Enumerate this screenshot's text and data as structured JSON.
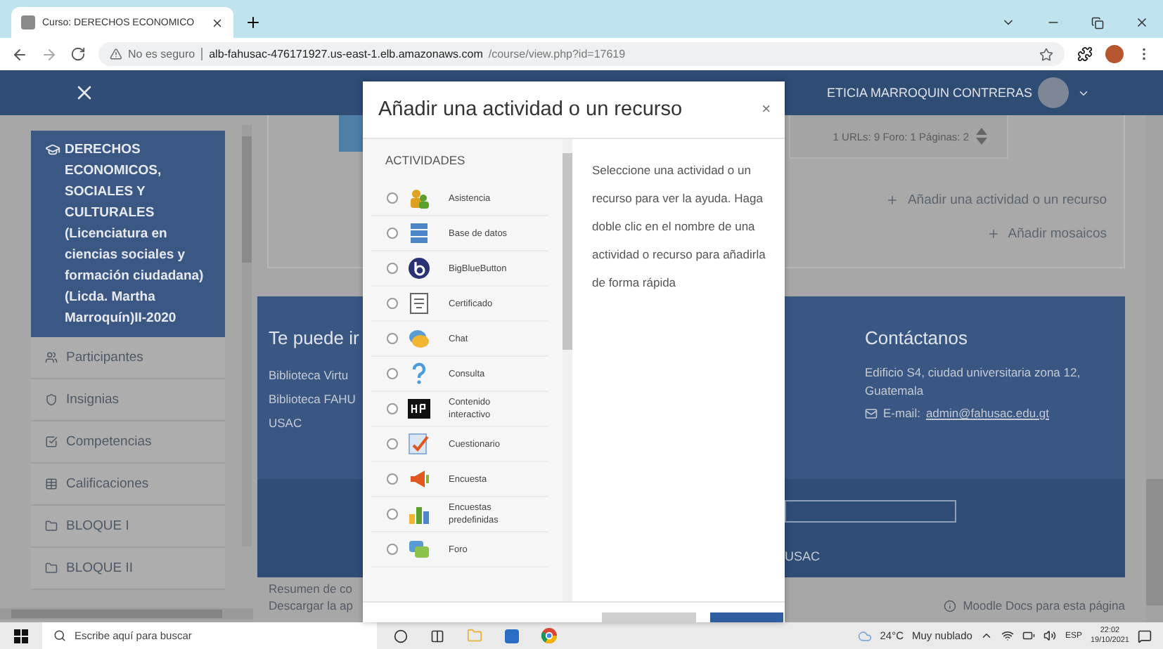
{
  "browser": {
    "tab_title": "Curso: DERECHOS ECONOMICO",
    "security": "No es seguro",
    "url_host": "alb-fahusac-476171927.us-east-1.elb.amazonaws.com",
    "url_path": "/course/view.php?id=17619"
  },
  "navbar": {
    "user_name": "ETICIA MARROQUIN CONTRERAS"
  },
  "sidebar": {
    "course": "DERECHOS ECONOMICOS, SOCIALES Y CULTURALES (Licenciatura en ciencias sociales y formación ciudadana)(Licda. Martha Marroquín)II-2020",
    "items": [
      {
        "label": "Participantes",
        "kind": "people"
      },
      {
        "label": "Insignias",
        "kind": "badge"
      },
      {
        "label": "Competencias",
        "kind": "check"
      },
      {
        "label": "Calificaciones",
        "kind": "table"
      },
      {
        "label": "BLOQUE I",
        "kind": "folder"
      },
      {
        "label": "BLOQUE II",
        "kind": "folder"
      }
    ]
  },
  "course": {
    "section_summary": "1 URLs: 9 Foro: 1 Páginas: 2",
    "add_activity": "Añadir una actividad o un recurso",
    "add_tiles": "Añadir mosaicos"
  },
  "footer": {
    "links_heading": "Te puede ir",
    "links": [
      "Biblioteca Virtu",
      "Biblioteca FAHU",
      "USAC"
    ],
    "contact_heading": "Contáctanos",
    "address": "Edificio S4, ciudad universitaria zona 12, Guatemala",
    "email_label": "E-mail:",
    "email": "admin@fahusac.edu.gt",
    "bottom_text": "USAC"
  },
  "page_bottom": {
    "lines": [
      "Resumen de co",
      "Descargar la ap"
    ],
    "docs_link": "Moodle Docs para esta página"
  },
  "modal": {
    "title": "Añadir una actividad o un recurso",
    "close": "×",
    "section": "ACTIVIDADES",
    "items": [
      {
        "label": "Asistencia",
        "selected": false
      },
      {
        "label": "Base de datos",
        "selected": false
      },
      {
        "label": "BigBlueButton",
        "selected": false
      },
      {
        "label": "Certificado",
        "selected": false
      },
      {
        "label": "Chat",
        "selected": false
      },
      {
        "label": "Consulta",
        "selected": false
      },
      {
        "label": "Contenido interactivo",
        "selected": false
      },
      {
        "label": "Cuestionario",
        "selected": false
      },
      {
        "label": "Encuesta",
        "selected": false
      },
      {
        "label": "Encuestas predefinidas",
        "selected": false
      },
      {
        "label": "Foro",
        "selected": false
      }
    ],
    "help": "Seleccione una actividad o un recurso para ver la ayuda. Haga doble clic en el nombre de una actividad o recurso para añadirla de forma rápida"
  },
  "taskbar": {
    "search_placeholder": "Escribe aquí para buscar",
    "temperature": "24°C",
    "condition": "Muy nublado",
    "language": "ESP",
    "time": "22:02",
    "date": "19/10/2021"
  }
}
